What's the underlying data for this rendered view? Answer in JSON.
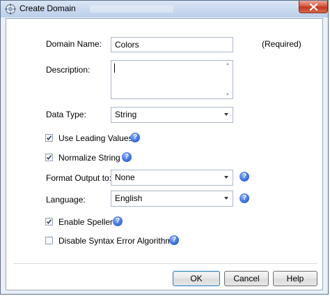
{
  "window": {
    "title": "Create Domain"
  },
  "colors": {
    "accent": "#3a6fdc",
    "close": "#c23a22",
    "titlebar": "#c8d8ee"
  },
  "form": {
    "domain_name": {
      "label": "Domain Name:",
      "value": "Colors",
      "required": "(Required)"
    },
    "description": {
      "label": "Description:",
      "value": ""
    },
    "data_type": {
      "label": "Data Type:",
      "value": "String"
    },
    "use_leading_values": {
      "label": "Use Leading Values",
      "checked": true
    },
    "normalize_string": {
      "label": "Normalize String",
      "checked": true
    },
    "format_output": {
      "label": "Format Output to:",
      "value": "None"
    },
    "language": {
      "label": "Language:",
      "value": "English"
    },
    "enable_speller": {
      "label": "Enable Speller",
      "checked": true
    },
    "disable_syntax": {
      "label": "Disable Syntax Error Algorithms",
      "checked": false
    }
  },
  "buttons": {
    "ok": "OK",
    "cancel": "Cancel",
    "help": "Help"
  },
  "help_glyph": "?"
}
